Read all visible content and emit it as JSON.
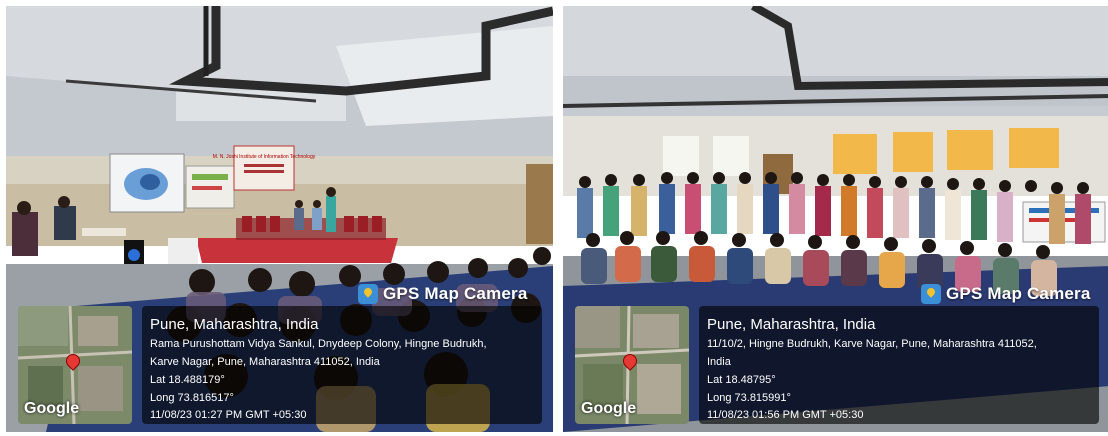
{
  "photos": [
    {
      "gps_badge": "GPS Map Camera",
      "location_title": "Pune, Maharashtra, India",
      "address_line1": "Rama Purushottam Vidya Sankul, Dnydeep Colony, Hingne Budrukh,",
      "address_line2": "Karve Nagar, Pune, Maharashtra 411052, India",
      "latitude": "Lat 18.488179°",
      "longitude": "Long 73.816517°",
      "timestamp": "11/08/23 01:27 PM GMT +05:30",
      "map_logo": "Google",
      "banner_text": "M. N. Joshi Institute of Information Technology"
    },
    {
      "gps_badge": "GPS Map Camera",
      "location_title": "Pune, Maharashtra, India",
      "address_line1": "11/10/2, Hingne Budrukh, Karve Nagar, Pune, Maharashtra 411052,",
      "address_line2": "India",
      "latitude": "Lat 18.48795°",
      "longitude": "Long 73.815991°",
      "timestamp": "11/08/23 01:56 PM GMT +05:30",
      "map_logo": "Google"
    }
  ],
  "colors": {
    "stage": "#c8323a",
    "floor_mat": "#2a3f78",
    "wall": "#d9d4c6",
    "ceiling": "#c9cfd6"
  }
}
